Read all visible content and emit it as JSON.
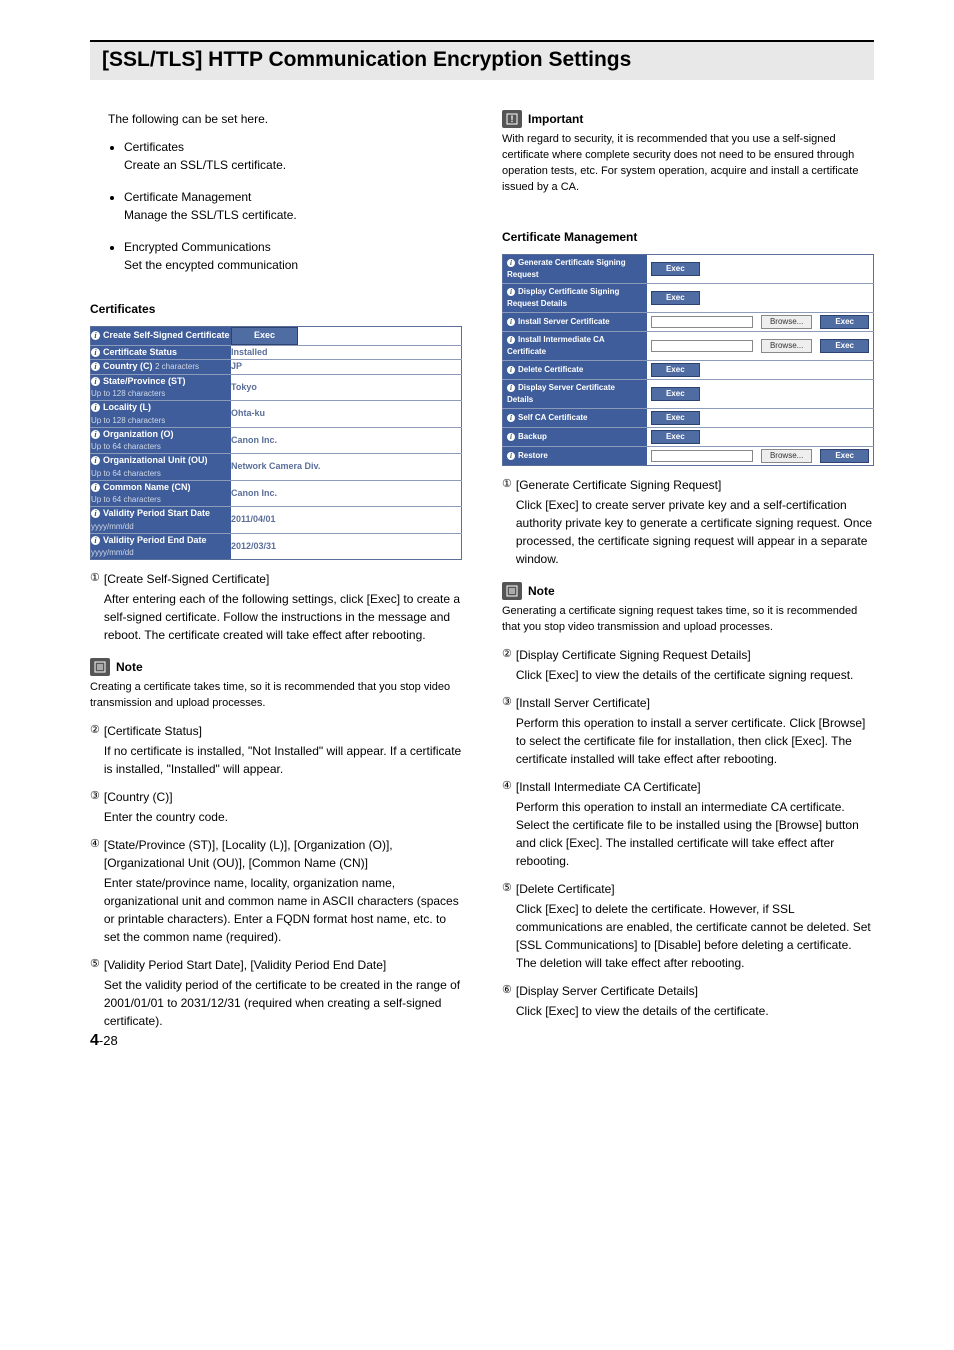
{
  "title": "[SSL/TLS] HTTP Communication Encryption Settings",
  "intro": "The following can be set here.",
  "bullets": [
    {
      "label": "Certificates",
      "desc": "Create an SSL/TLS certificate."
    },
    {
      "label": "Certificate Management",
      "desc": "Manage the SSL/TLS certificate."
    },
    {
      "label": "Encrypted Communications",
      "desc": "Set the encypted communication"
    }
  ],
  "certHeader": "Certificates",
  "certTable": [
    {
      "label": "Create Self-Signed Certificate",
      "sub": "",
      "value": "",
      "btn": "Exec"
    },
    {
      "label": "Certificate Status",
      "sub": "",
      "value": "Installed"
    },
    {
      "label": "Country (C)",
      "sub": "2 characters",
      "value": "JP"
    },
    {
      "label": "State/Province (ST)",
      "sub": "Up to 128 characters",
      "value": "Tokyo"
    },
    {
      "label": "Locality (L)",
      "sub": "Up to 128 characters",
      "value": "Ohta-ku"
    },
    {
      "label": "Organization (O)",
      "sub": "Up to 64 characters",
      "value": "Canon Inc."
    },
    {
      "label": "Organizational Unit (OU)",
      "sub": "Up to 64 characters",
      "value": "Network Camera Div."
    },
    {
      "label": "Common Name (CN)",
      "sub": "Up to 64 characters",
      "value": "Canon Inc."
    },
    {
      "label": "Validity Period Start Date",
      "sub": "yyyy/mm/dd",
      "value": "2011/04/01"
    },
    {
      "label": "Validity Period End Date",
      "sub": "yyyy/mm/dd",
      "value": "2012/03/31"
    }
  ],
  "leftItems": [
    {
      "n": "①",
      "label": "[Create Self-Signed Certificate]",
      "desc": "After entering each of the following settings, click [Exec] to create a self-signed certificate. Follow the instructions in the message and reboot. The certificate created will take effect after rebooting."
    }
  ],
  "note1Title": "Note",
  "note1": "Creating a certificate takes time, so it is recommended that you stop video transmission and upload processes.",
  "leftItems2": [
    {
      "n": "②",
      "label": "[Certificate Status]",
      "desc": "If no certificate is installed, \"Not Installed\" will appear. If a certificate is installed, \"Installed\" will appear."
    },
    {
      "n": "③",
      "label": "[Country (C)]",
      "desc": "Enter the country code."
    },
    {
      "n": "④",
      "label": "[State/Province (ST)], [Locality (L)], [Organization (O)], [Organizational Unit (OU)], [Common Name (CN)]",
      "desc": "Enter state/province name, locality, organization name, organizational unit and common name in ASCII characters (spaces or printable characters). Enter a FQDN format host name, etc. to set the common name (required)."
    },
    {
      "n": "⑤",
      "label": "[Validity Period Start Date], [Validity Period End Date]",
      "desc": "Set the validity period of the certificate to be created in the range of 2001/01/01 to 2031/12/31 (required when creating a self-signed certificate)."
    }
  ],
  "importantTitle": "Important",
  "important": "With regard to security, it is recommended that you use a self-signed certificate where complete security does not need to be ensured through operation tests, etc. For system operation, acquire and install a certificate issued by a CA.",
  "cmHeader": "Certificate Management",
  "cmRows": [
    {
      "label": "Generate Certificate Signing Request",
      "exec": true
    },
    {
      "label": "Display Certificate Signing Request Details",
      "exec": true
    },
    {
      "label": "Install Server Certificate",
      "field": true,
      "browse": "Browse...",
      "execR": true
    },
    {
      "label": "Install Intermediate CA Certificate",
      "field": true,
      "browse": "Browse...",
      "execR": true
    },
    {
      "label": "Delete Certificate",
      "exec": true
    },
    {
      "label": "Display Server Certificate Details",
      "exec": true
    },
    {
      "label": "Self CA Certificate",
      "exec": true
    },
    {
      "label": "Backup",
      "exec": true
    },
    {
      "label": "Restore",
      "field": true,
      "browse": "Browse...",
      "execR": true
    }
  ],
  "cmExec": "Exec",
  "rightItems1": [
    {
      "n": "①",
      "label": "[Generate Certificate Signing Request]",
      "desc": "Click [Exec] to create server private key and a self-certification authority private key to generate a certificate signing request. Once processed, the certificate signing request will appear in a separate window."
    }
  ],
  "note2Title": "Note",
  "note2": "Generating a certificate signing request takes time, so it is recommended that you stop video transmission and upload processes.",
  "rightItems2": [
    {
      "n": "②",
      "label": "[Display Certificate Signing Request Details]",
      "desc": "Click [Exec] to view the details of the certificate signing request."
    },
    {
      "n": "③",
      "label": "[Install Server Certificate]",
      "desc": "Perform this operation to install a server certificate. Click [Browse] to select the certificate file for installation, then click [Exec]. The certificate installed will take effect after rebooting."
    },
    {
      "n": "④",
      "label": "[Install Intermediate CA Certificate]",
      "desc": "Perform this operation to install an intermediate CA certificate. Select the certificate file to be installed using the [Browse] button and click [Exec]. The installed certificate will take effect after rebooting."
    },
    {
      "n": "⑤",
      "label": "[Delete Certificate]",
      "desc": "Click [Exec] to delete the certificate. However, if SSL communications are enabled, the certificate cannot be deleted. Set [SSL Communications] to [Disable] before deleting a certificate. The deletion will take effect after rebooting."
    },
    {
      "n": "⑥",
      "label": "[Display Server Certificate Details]",
      "desc": "Click [Exec] to view the details of the certificate."
    }
  ],
  "pageNum": {
    "big": "4",
    "small": "-28"
  }
}
